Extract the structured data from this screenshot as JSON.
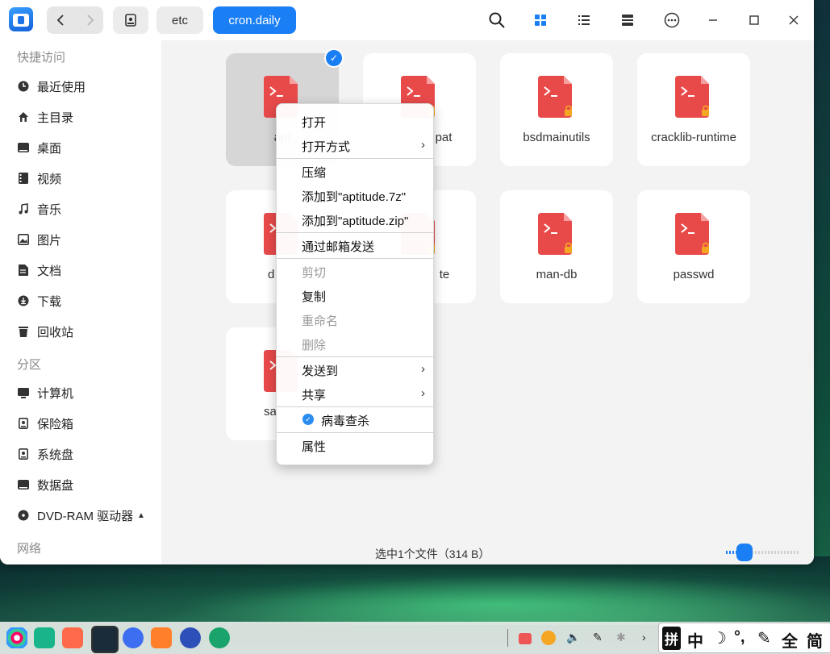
{
  "titlebar": {
    "breadcrumbs": [
      "etc",
      "cron.daily"
    ],
    "accent_color": "#1a7ff5"
  },
  "sidebar": {
    "section_quick": "快捷访问",
    "quick_items": [
      {
        "label": "最近使用",
        "icon": "clock-icon"
      },
      {
        "label": "主目录",
        "icon": "home-icon"
      },
      {
        "label": "桌面",
        "icon": "desktop-icon"
      },
      {
        "label": "视频",
        "icon": "video-icon"
      },
      {
        "label": "音乐",
        "icon": "music-icon"
      },
      {
        "label": "图片",
        "icon": "picture-icon"
      },
      {
        "label": "文档",
        "icon": "document-icon"
      },
      {
        "label": "下载",
        "icon": "download-icon"
      },
      {
        "label": "回收站",
        "icon": "trash-icon"
      }
    ],
    "section_partition": "分区",
    "partition_items": [
      {
        "label": "计算机",
        "icon": "computer-icon"
      },
      {
        "label": "保险箱",
        "icon": "vault-icon"
      },
      {
        "label": "系统盘",
        "icon": "system-disk-icon"
      },
      {
        "label": "数据盘",
        "icon": "data-disk-icon"
      },
      {
        "label": "DVD-RAM 驱动器",
        "icon": "dvd-icon"
      }
    ],
    "section_network": "网络"
  },
  "files": [
    {
      "name": "apt",
      "selected": true
    },
    {
      "name": "pat",
      "locked": true
    },
    {
      "name": "bsdmainutils",
      "locked": true
    },
    {
      "name": "cracklib-runtime",
      "locked": true
    },
    {
      "name": "d",
      "locked": true
    },
    {
      "name": "te",
      "locked": true
    },
    {
      "name": "man-db",
      "locked": true
    },
    {
      "name": "passwd",
      "locked": true
    },
    {
      "name": "sa",
      "locked": true
    }
  ],
  "context_menu": {
    "open": "打开",
    "open_with": "打开方式",
    "compress": "压缩",
    "add_7z": "添加到\"aptitude.7z\"",
    "add_zip": "添加到\"aptitude.zip\"",
    "send_mail": "通过邮箱发送",
    "cut": "剪切",
    "copy": "复制",
    "rename": "重命名",
    "delete": "删除",
    "send_to": "发送到",
    "share": "共享",
    "virus_scan": "病毒查杀",
    "properties": "属性"
  },
  "status": {
    "text": "选中1个文件（314 B）",
    "zoom_level": 0.25
  },
  "ime": {
    "mode_pinyin": "拼",
    "mode_chinese": "中",
    "moon": "☽",
    "punct": "°,",
    "pen": "✎",
    "full": "全",
    "simplified": "简"
  }
}
